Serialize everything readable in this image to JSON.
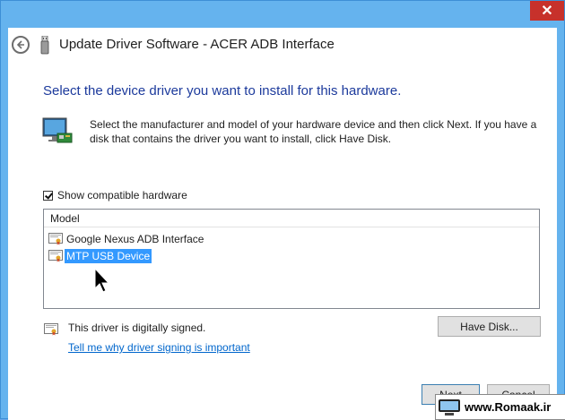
{
  "window": {
    "title": "Update Driver Software - ACER ADB Interface",
    "close_glyph": "✕"
  },
  "content": {
    "heading": "Select the device driver you want to install for this hardware.",
    "description": "Select the manufacturer and model of your hardware device and then click Next. If you have a disk that contains the driver you want to install, click Have Disk.",
    "hardware_icon": "monitor-hardware-icon"
  },
  "compatible": {
    "label": "Show compatible hardware",
    "checked": true
  },
  "model_list": {
    "column_header": "Model",
    "items": [
      {
        "label": "Google Nexus ADB Interface",
        "selected": false
      },
      {
        "label": "MTP USB Device",
        "selected": true
      }
    ]
  },
  "signing": {
    "status_text": "This driver is digitally signed.",
    "link_text": "Tell me why driver signing is important"
  },
  "buttons": {
    "have_disk": "Have Disk...",
    "next": "Next",
    "cancel": "Cancel"
  },
  "watermark": {
    "text": "www.Romaak.ir"
  },
  "colors": {
    "title_bar": "#65b3ee",
    "close_button": "#c7312b",
    "heading": "#1c3a9c",
    "link": "#0066cc",
    "selection": "#3399ff"
  }
}
